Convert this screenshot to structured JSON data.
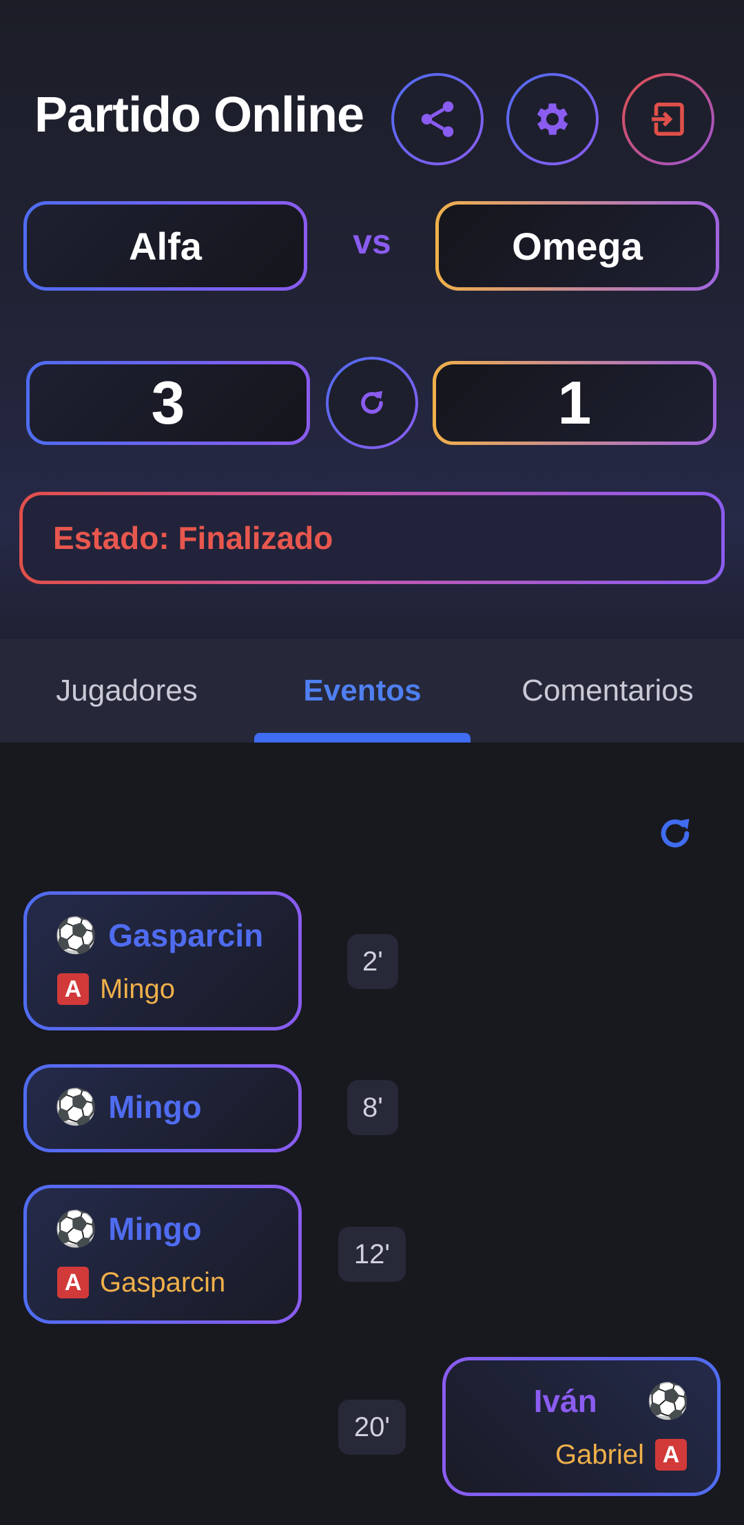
{
  "header": {
    "title": "Partido Online"
  },
  "match": {
    "home_team": "Alfa",
    "away_team": "Omega",
    "vs_label": "vs",
    "home_score": "3",
    "away_score": "1",
    "status_text": "Estado: Finalizado"
  },
  "tabs": [
    {
      "label": "Jugadores"
    },
    {
      "label": "Eventos"
    },
    {
      "label": "Comentarios"
    }
  ],
  "active_tab": "Eventos",
  "events": [
    {
      "minute": "2'",
      "side": "home",
      "scorer": "Gasparcin",
      "assist": "Mingo"
    },
    {
      "minute": "8'",
      "side": "home",
      "scorer": "Mingo",
      "assist": ""
    },
    {
      "minute": "12'",
      "side": "home",
      "scorer": "Mingo",
      "assist": "Gasparcin"
    },
    {
      "minute": "20'",
      "side": "away",
      "scorer": "Iván",
      "assist": "Gabriel"
    }
  ],
  "icons": {
    "share": "share-icon",
    "settings": "gear-icon",
    "exit": "exit-icon",
    "refresh": "refresh-icon",
    "goal": "soccer-ball-icon",
    "assist": "assist-badge-icon"
  },
  "colors": {
    "accent_blue": "#4f6cf0",
    "accent_purple": "#8a5cf0",
    "accent_orange": "#f0b04a",
    "status_red": "#e8574e"
  }
}
